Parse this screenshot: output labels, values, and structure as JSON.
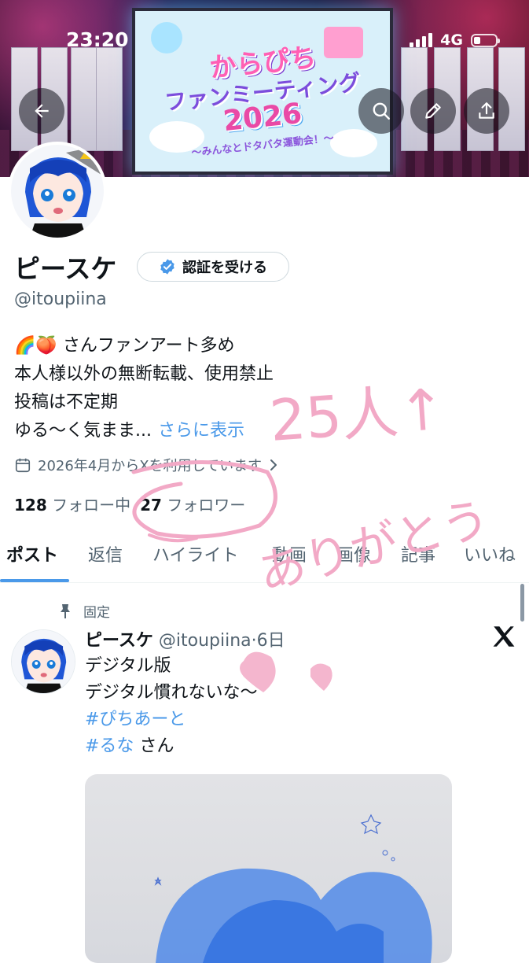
{
  "status_bar": {
    "time": "23:20",
    "network": "4G",
    "battery_level": 0.3
  },
  "banner": {
    "screen_text": {
      "line1": "からぴち",
      "line2": "ファンミーティング",
      "line3": "2026",
      "line4": "～みんなとドタバタ運動会！～"
    }
  },
  "header_buttons": {
    "back": "back-arrow-icon",
    "search": "search-icon",
    "edit": "pencil-icon",
    "share": "share-icon"
  },
  "profile": {
    "display_name": "ピースケ",
    "verify_label": "認証を受ける",
    "handle": "@itoupiina",
    "bio_emoji_1": "🌈",
    "bio_emoji_2": "🍑",
    "bio_line1": "さんファンアート多め",
    "bio_line2": "本人様以外の無断転載、使用禁止",
    "bio_line3": "投稿は不定期",
    "bio_line4": "ゆる～く気まま...",
    "more_label": "さらに表示",
    "joined": "2026年4月からXを利用しています",
    "following_count": "128",
    "following_label": "フォロー中",
    "followers_count": "27",
    "followers_label": "フォロワー"
  },
  "tabs": [
    {
      "label": "ポスト"
    },
    {
      "label": "返信"
    },
    {
      "label": "ハイライト"
    },
    {
      "label": "動画"
    },
    {
      "label": "画像"
    },
    {
      "label": "記事"
    },
    {
      "label": "いいね"
    }
  ],
  "pinned_post": {
    "pinned_label": "固定",
    "author_name": "ピースケ",
    "author_handle": "@itoupiina",
    "time": "6日",
    "line1": "デジタル版",
    "line2": "デジタル慣れないな〜",
    "hashtag1": "#ぴちあーと",
    "hashtag2": "#るな",
    "hashtag2_suffix": "さん"
  },
  "handwriting": {
    "line1": "25人↑",
    "line2": "ありがとう"
  },
  "colors": {
    "accent": "#4a99e9",
    "verified_badge": "#4a99e9",
    "text_primary": "#0f1419",
    "text_secondary": "#536471",
    "handwriting_pink": "#f2a9c6"
  }
}
